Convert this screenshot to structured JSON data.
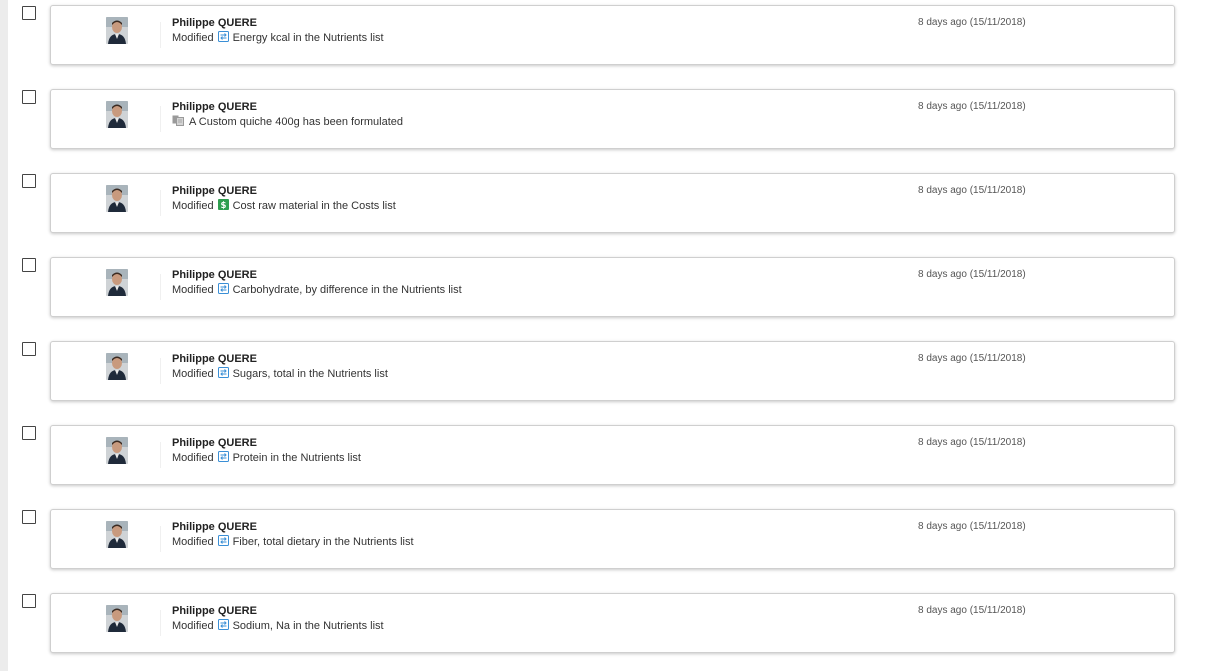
{
  "feed": {
    "items": [
      {
        "author": "Philippe QUERE",
        "action": "Modified",
        "icon": "nutrients-list-icon",
        "object": "Energy kcal in the Nutrients list",
        "time": "8 days ago (15/11/2018)"
      },
      {
        "author": "Philippe QUERE",
        "action": "",
        "icon": "formulation-icon",
        "object": "A Custom quiche 400g has been formulated",
        "time": "8 days ago (15/11/2018)"
      },
      {
        "author": "Philippe QUERE",
        "action": "Modified",
        "icon": "costs-list-icon",
        "object": "Cost raw material in the Costs list",
        "time": "8 days ago (15/11/2018)"
      },
      {
        "author": "Philippe QUERE",
        "action": "Modified",
        "icon": "nutrients-list-icon",
        "object": "Carbohydrate, by difference in the Nutrients list",
        "time": "8 days ago (15/11/2018)"
      },
      {
        "author": "Philippe QUERE",
        "action": "Modified",
        "icon": "nutrients-list-icon",
        "object": "Sugars, total in the Nutrients list",
        "time": "8 days ago (15/11/2018)"
      },
      {
        "author": "Philippe QUERE",
        "action": "Modified",
        "icon": "nutrients-list-icon",
        "object": "Protein in the Nutrients list",
        "time": "8 days ago (15/11/2018)"
      },
      {
        "author": "Philippe QUERE",
        "action": "Modified",
        "icon": "nutrients-list-icon",
        "object": "Fiber, total dietary in the Nutrients list",
        "time": "8 days ago (15/11/2018)"
      },
      {
        "author": "Philippe QUERE",
        "action": "Modified",
        "icon": "nutrients-list-icon",
        "object": "Sodium, Na in the Nutrients list",
        "time": "8 days ago (15/11/2018)"
      }
    ]
  },
  "colors": {
    "nutrients_icon": "#3a8fd6",
    "costs_icon": "#2e9e4f",
    "formulation_icon": "#9a9a9a"
  }
}
